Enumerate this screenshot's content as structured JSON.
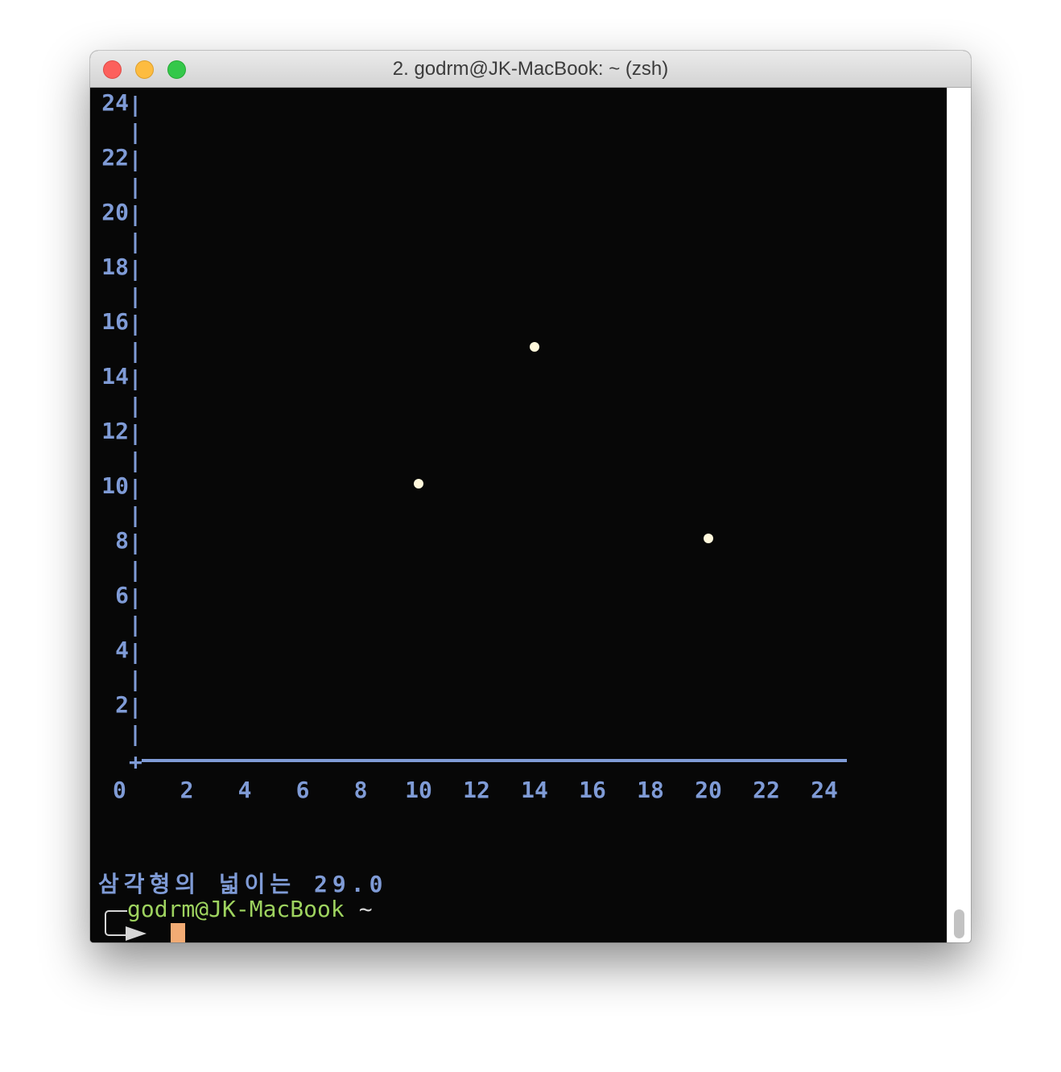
{
  "window": {
    "title": "2. godrm@JK-MacBook: ~ (zsh)"
  },
  "chart_data": {
    "type": "scatter",
    "x_ticks": [
      "0",
      "2",
      "4",
      "6",
      "8",
      "10",
      "12",
      "14",
      "16",
      "18",
      "20",
      "22",
      "24"
    ],
    "y_ticks": [
      "2",
      "4",
      "6",
      "8",
      "10",
      "12",
      "14",
      "16",
      "18",
      "20",
      "22",
      "24"
    ],
    "xlim": [
      0,
      24
    ],
    "ylim": [
      0,
      24
    ],
    "origin_marker": "+",
    "points": [
      {
        "x": 10,
        "y": 10
      },
      {
        "x": 14,
        "y": 15
      },
      {
        "x": 20,
        "y": 8
      }
    ],
    "point_color": "#fff8dc",
    "axis_color": "#7f9bd6"
  },
  "output": {
    "result_line": "삼각형의 넓이는 29.0"
  },
  "prompt": {
    "user_host": "godrm@JK-MacBook",
    "path": "~"
  },
  "colors": {
    "terminal_bg": "#070707",
    "prompt_user": "#9ed35f",
    "cursor": "#f2ab74"
  }
}
